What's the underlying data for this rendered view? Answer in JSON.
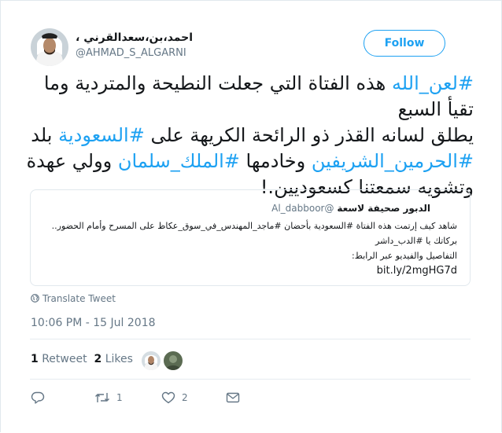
{
  "author": {
    "name": "، احمد،بن،سعدالقرني",
    "handle": "@AHMAD_S_ALGARNI"
  },
  "follow_label": "Follow",
  "tweet": {
    "line1_hashtag": "#لعن_الله",
    "line1_text": " هذه الفتاة التي جعلت النطيحة والمتردية وما تقيأ السبع",
    "line2_text": "يطلق لسانه القذر ذو الرائحة الكريهة على ",
    "line2_hashtag": "#السعودية",
    "line2_tail": " بلد",
    "line3_hashtag1": "#الحرمين_الشريفين",
    "line3_text": "  وخادمها ",
    "line3_hashtag2": "#الملك_سلمان",
    "line3_tail": " وولي عهدة",
    "line4_text": "وتشويه سمعتنا كسعوديين.!"
  },
  "quoted": {
    "name": "الدبور صحيفة لاسعة",
    "handle": "@Al_dabboor",
    "line1": "شاهد كيف إرتمت هذه الفتاة #السعودية بأحضان #ماجد_المهندس_في_سوق_عكاظ  على المسرح وأمام الحضور..",
    "line2": "بركاتك يا #الدب_داشر",
    "line3": "التفاصيل والفيديو عبر الرابط:",
    "link": "bit.ly/2mgHG7d"
  },
  "translate_label": "Translate Tweet",
  "timestamp": "10:06 PM - 15 Jul 2018",
  "stats": {
    "retweets_count": "1",
    "retweets_label": "Retweet",
    "likes_count": "2",
    "likes_label": "Likes"
  },
  "actions": {
    "retweet_count": "1",
    "like_count": "2"
  },
  "colors": {
    "accent": "#1da1f2",
    "text": "#14171a",
    "muted": "#657786",
    "border": "#e1e8ed"
  },
  "icons": [
    "globe-icon",
    "reply-icon",
    "retweet-icon",
    "heart-icon",
    "mail-icon"
  ]
}
